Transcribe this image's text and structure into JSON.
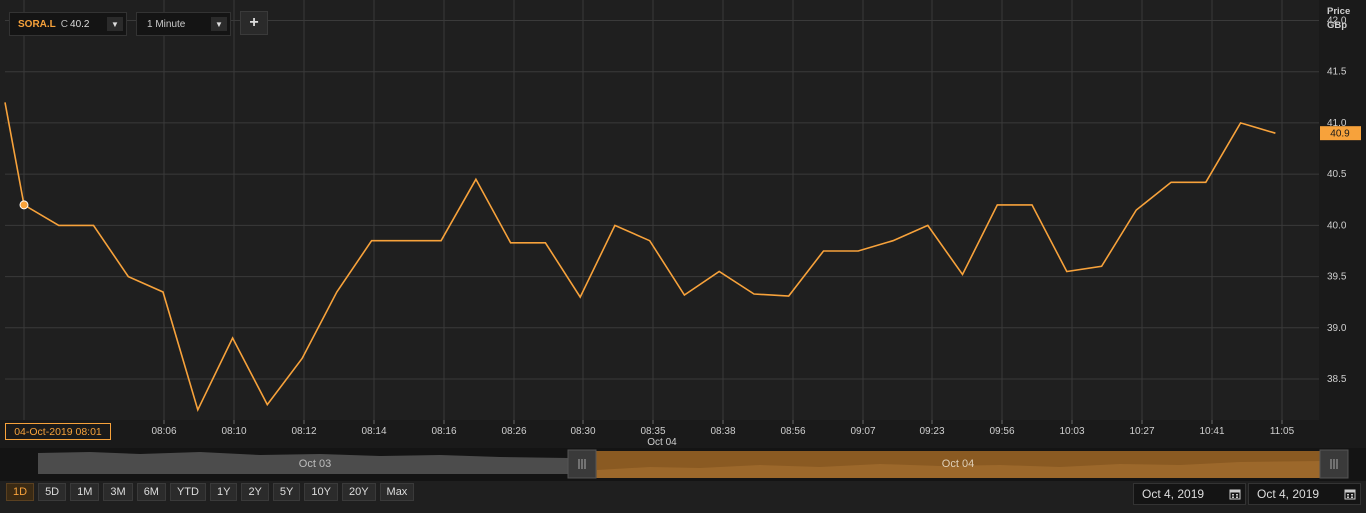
{
  "toolbar": {
    "symbol": "SORA.L",
    "close_label": "C",
    "close_value": "40.2",
    "interval": "1 Minute",
    "add_label": "+"
  },
  "axis": {
    "price_label": "Price",
    "unit_label": "GBp",
    "current_price_tag": "40.9",
    "crosshair_time": "04-Oct-2019 08:01",
    "date_label": "Oct 04"
  },
  "navigator": {
    "left_label": "Oct 03",
    "right_label": "Oct 04"
  },
  "range_buttons": [
    "1D",
    "5D",
    "1M",
    "3M",
    "6M",
    "YTD",
    "1Y",
    "2Y",
    "5Y",
    "10Y",
    "20Y",
    "Max"
  ],
  "active_range": "1D",
  "date_range": {
    "from": "Oct 4, 2019",
    "to": "Oct 4, 2019"
  },
  "colors": {
    "accent": "#f7a23b",
    "background": "#1f1f1f",
    "grid": "#3a3a3a"
  },
  "chart_data": {
    "type": "line",
    "title": "",
    "xlabel": "",
    "ylabel": "Price GBp",
    "ylim": [
      38.1,
      42.2
    ],
    "yticks": [
      38.5,
      39.0,
      39.5,
      40.0,
      40.5,
      41.0,
      41.5,
      42.0
    ],
    "xtick_labels": [
      "08:06",
      "08:10",
      "08:12",
      "08:14",
      "08:16",
      "08:26",
      "08:30",
      "08:35",
      "08:38",
      "08:56",
      "09:07",
      "09:23",
      "09:56",
      "10:03",
      "10:27",
      "10:41",
      "11:05"
    ],
    "grid": true,
    "series": [
      {
        "values": [
          41.2,
          40.2,
          40.0,
          40.0,
          39.5,
          39.35,
          38.2,
          38.9,
          38.25,
          38.7,
          39.35,
          39.85,
          39.85,
          39.85,
          40.45,
          39.83,
          39.83,
          39.3,
          40.0,
          39.85,
          39.32,
          39.55,
          39.33,
          39.31,
          39.75,
          39.75,
          39.85,
          40.0,
          39.52,
          40.2,
          40.2,
          39.55,
          39.6,
          40.15,
          40.42,
          40.42,
          41.0,
          40.9
        ]
      }
    ]
  }
}
